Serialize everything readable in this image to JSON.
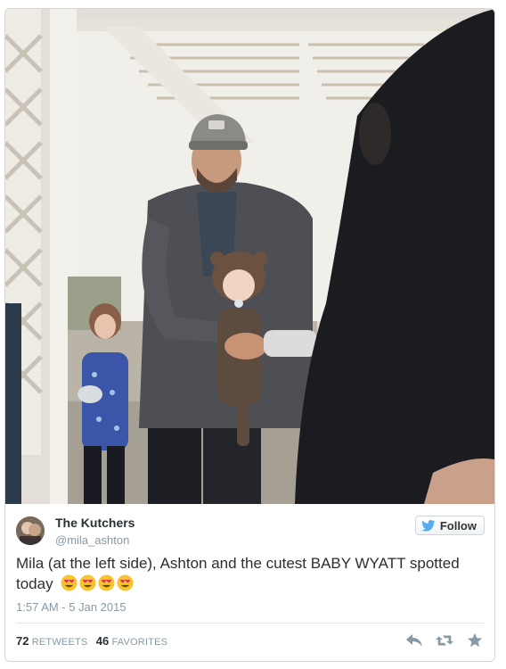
{
  "tweet": {
    "author_name": "The Kutchers",
    "author_handle": "@mila_ashton",
    "follow_label": "Follow",
    "text": "Mila (at the left side), Ashton and the cutest BABY WYATT spotted today",
    "emoji": [
      "heart-eyes-emoji",
      "heart-eyes-emoji",
      "heart-eyes-emoji",
      "heart-eyes-emoji"
    ],
    "timestamp": "1:57 AM - 5 Jan 2015",
    "retweets_count": "72",
    "retweets_label": "RETWEETS",
    "favorites_count": "46",
    "favorites_label": "FAVORITES"
  },
  "icons": {
    "follow": "twitter-bird-icon",
    "reply": "reply-icon",
    "retweet": "retweet-icon",
    "favorite": "star-icon"
  },
  "colors": {
    "accent": "#55acee",
    "secondary_text": "#8899a6",
    "primary_text": "#292f33"
  }
}
